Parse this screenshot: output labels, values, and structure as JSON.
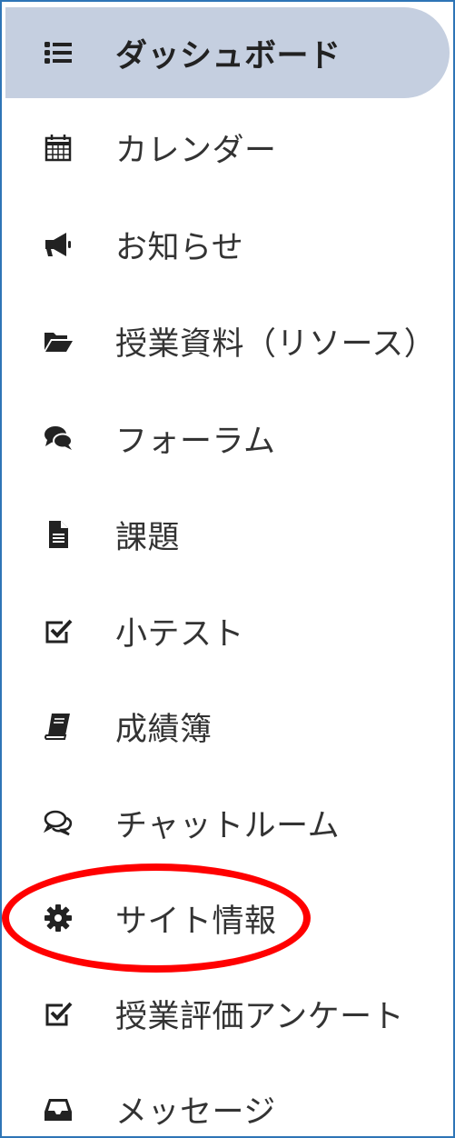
{
  "nav": {
    "items": [
      {
        "label": "ダッシュボード",
        "icon": "list-icon",
        "active": true
      },
      {
        "label": "カレンダー",
        "icon": "calendar-icon"
      },
      {
        "label": "お知らせ",
        "icon": "megaphone-icon"
      },
      {
        "label": "授業資料（リソース）",
        "icon": "folder-open-icon"
      },
      {
        "label": "フォーラム",
        "icon": "comments-icon"
      },
      {
        "label": "課題",
        "icon": "file-text-icon"
      },
      {
        "label": "小テスト",
        "icon": "check-square-icon"
      },
      {
        "label": "成績簿",
        "icon": "book-icon"
      },
      {
        "label": "チャットルーム",
        "icon": "comments-outline-icon"
      },
      {
        "label": "サイト情報",
        "icon": "gear-icon",
        "highlighted": true
      },
      {
        "label": "授業評価アンケート",
        "icon": "check-square-icon"
      },
      {
        "label": "メッセージ",
        "icon": "inbox-icon"
      }
    ]
  },
  "colors": {
    "active_bg": "#c5cfe0",
    "frame_border": "#2e75b6",
    "highlight": "#ff0000",
    "icon": "#222222"
  }
}
